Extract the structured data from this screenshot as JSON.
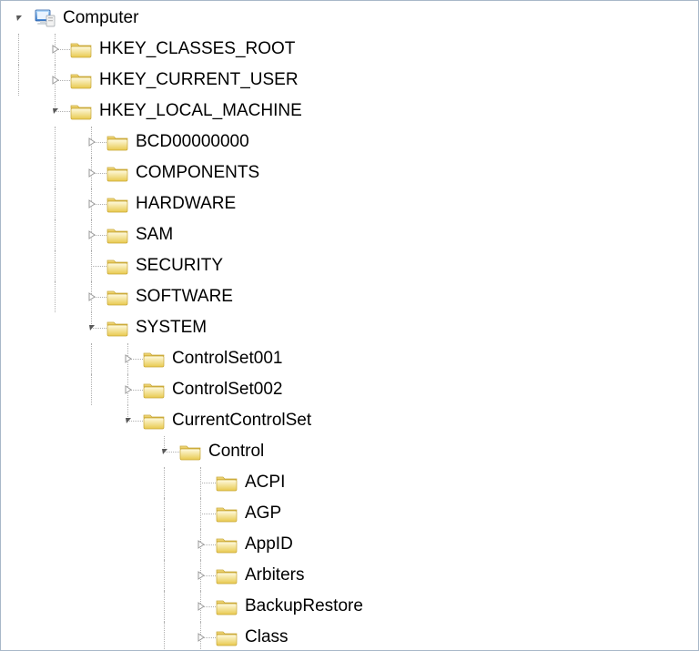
{
  "root": {
    "label": "Computer",
    "icon": "computer",
    "state": "open",
    "children": [
      {
        "label": "HKEY_CLASSES_ROOT",
        "icon": "folder",
        "state": "closed"
      },
      {
        "label": "HKEY_CURRENT_USER",
        "icon": "folder",
        "state": "closed"
      },
      {
        "label": "HKEY_LOCAL_MACHINE",
        "icon": "folder",
        "state": "open",
        "children": [
          {
            "label": "BCD00000000",
            "icon": "folder",
            "state": "closed"
          },
          {
            "label": "COMPONENTS",
            "icon": "folder",
            "state": "closed"
          },
          {
            "label": "HARDWARE",
            "icon": "folder",
            "state": "closed"
          },
          {
            "label": "SAM",
            "icon": "folder",
            "state": "closed"
          },
          {
            "label": "SECURITY",
            "icon": "folder",
            "state": "leaf"
          },
          {
            "label": "SOFTWARE",
            "icon": "folder",
            "state": "closed"
          },
          {
            "label": "SYSTEM",
            "icon": "folder",
            "state": "open",
            "children": [
              {
                "label": "ControlSet001",
                "icon": "folder",
                "state": "closed"
              },
              {
                "label": "ControlSet002",
                "icon": "folder",
                "state": "closed"
              },
              {
                "label": "CurrentControlSet",
                "icon": "folder",
                "state": "open",
                "children": [
                  {
                    "label": "Control",
                    "icon": "folder",
                    "state": "open",
                    "children": [
                      {
                        "label": "ACPI",
                        "icon": "folder",
                        "state": "leaf"
                      },
                      {
                        "label": "AGP",
                        "icon": "folder",
                        "state": "leaf"
                      },
                      {
                        "label": "AppID",
                        "icon": "folder",
                        "state": "closed"
                      },
                      {
                        "label": "Arbiters",
                        "icon": "folder",
                        "state": "closed"
                      },
                      {
                        "label": "BackupRestore",
                        "icon": "folder",
                        "state": "closed"
                      },
                      {
                        "label": "Class",
                        "icon": "folder",
                        "state": "closed",
                        "more": true
                      }
                    ]
                  }
                ]
              }
            ]
          }
        ]
      }
    ]
  }
}
